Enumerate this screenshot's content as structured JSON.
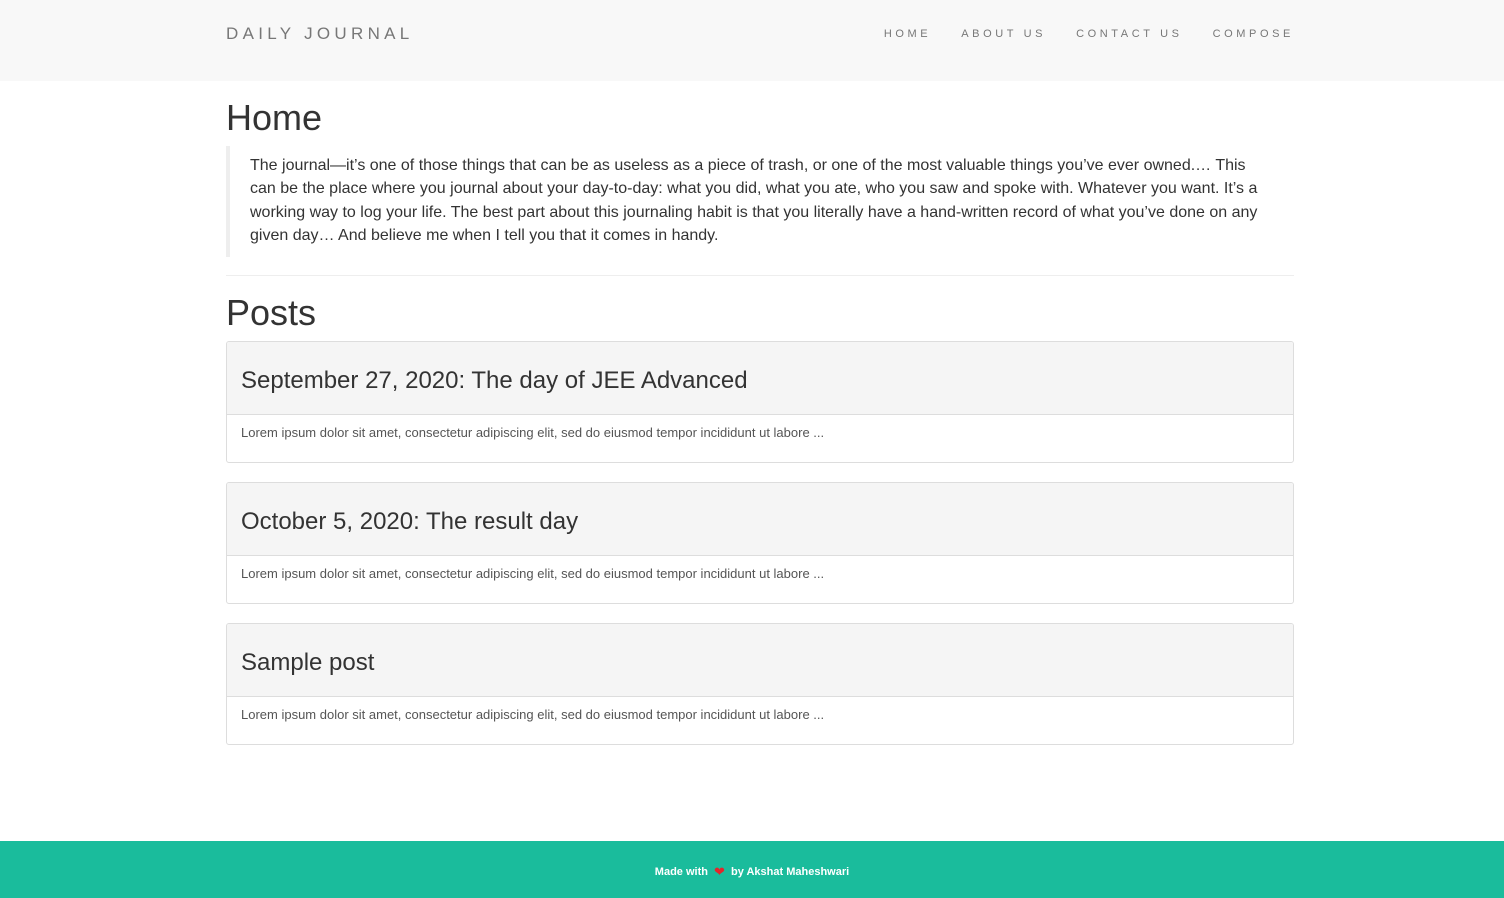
{
  "navbar": {
    "brand": "DAILY JOURNAL",
    "links": [
      {
        "label": "HOME"
      },
      {
        "label": "ABOUT US"
      },
      {
        "label": "CONTACT US"
      },
      {
        "label": "COMPOSE"
      }
    ]
  },
  "main": {
    "title": "Home",
    "intro": "The journal—it’s one of those things that can be as useless as a piece of trash, or one of the most valuable things you’ve ever owned.… This can be the place where you journal about your day-to-day: what you did, what you ate, who you saw and spoke with. Whatever you want. It’s a working way to log your life. The best part about this journaling habit is that you literally have a hand-written record of what you’ve done on any given day… And believe me when I tell you that it comes in handy.",
    "posts_title": "Posts",
    "posts": [
      {
        "title": "September 27, 2020: The day of JEE Advanced",
        "excerpt": "Lorem ipsum dolor sit amet, consectetur adipiscing elit, sed do eiusmod tempor incididunt ut labore ..."
      },
      {
        "title": "October 5, 2020: The result day",
        "excerpt": "Lorem ipsum dolor sit amet, consectetur adipiscing elit, sed do eiusmod tempor incididunt ut labore ..."
      },
      {
        "title": "Sample post",
        "excerpt": "Lorem ipsum dolor sit amet, consectetur adipiscing elit, sed do eiusmod tempor incididunt ut labore ..."
      }
    ]
  },
  "footer": {
    "prefix": "Made with",
    "heart_icon": "heart-icon",
    "suffix": "by Akshat Maheshwari"
  },
  "colors": {
    "navbar_bg": "#f8f8f8",
    "footer_bg": "#1abc9c",
    "heart": "#e3262b",
    "panel_heading_bg": "#f5f5f5"
  }
}
